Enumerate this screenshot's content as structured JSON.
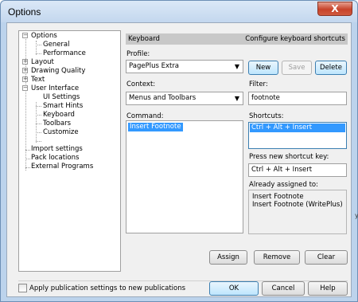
{
  "window": {
    "title": "Options",
    "close_glyph": "X"
  },
  "tree": {
    "items": [
      {
        "label": "Options",
        "expander": "−"
      },
      {
        "label": "General"
      },
      {
        "label": "Performance"
      },
      {
        "label": "Layout",
        "expander": "+"
      },
      {
        "label": "Drawing Quality",
        "expander": "+"
      },
      {
        "label": "Text",
        "expander": "+"
      },
      {
        "label": "User Interface",
        "expander": "−"
      },
      {
        "label": "UI Settings"
      },
      {
        "label": "Smart Hints"
      },
      {
        "label": "Keyboard"
      },
      {
        "label": "Toolbars"
      },
      {
        "label": "Customize"
      },
      {
        "label": "Import settings"
      },
      {
        "label": "Pack locations"
      },
      {
        "label": "External Programs"
      }
    ]
  },
  "panel": {
    "header_left": "Keyboard",
    "header_right": "Configure keyboard shortcuts",
    "profile_label": "Profile:",
    "profile_value": "PagePlus Extra",
    "new_label": "New",
    "save_label": "Save",
    "delete_label": "Delete",
    "context_label": "Context:",
    "context_value": "Menus and Toolbars",
    "filter_label": "Filter:",
    "filter_value": "footnote",
    "command_label": "Command:",
    "command_items": [
      "Insert Footnote"
    ],
    "shortcuts_label": "Shortcuts:",
    "shortcut_items": [
      "Ctrl + Alt + Insert"
    ],
    "press_label": "Press new shortcut key:",
    "press_value": "Ctrl + Alt + Insert",
    "assigned_label": "Already assigned to:",
    "assigned_items": [
      "Insert Footnote",
      "Insert Footnote (WritePlus)"
    ],
    "assign_label": "Assign",
    "remove_label": "Remove",
    "clear_label": "Clear"
  },
  "footer": {
    "apply_label": "Apply publication settings to new publications",
    "ok_label": "OK",
    "cancel_label": "Cancel",
    "help_label": "Help"
  },
  "edge_mark": "y"
}
